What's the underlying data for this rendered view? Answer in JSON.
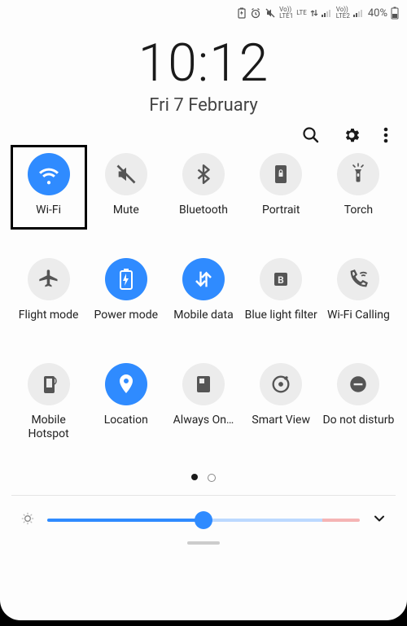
{
  "status": {
    "battery_percent": "40%",
    "carrier1": "LTE1",
    "carrier2": "LTE2",
    "volte1": "Vo))",
    "volte2": "Vo))",
    "net": "LTE"
  },
  "clock": "10:12",
  "date": "Fri 7 February",
  "actions": {
    "search": "search-icon",
    "settings": "gear-icon",
    "more": "more-icon"
  },
  "tiles": [
    {
      "id": "wifi",
      "label": "Wi-Fi",
      "active": true
    },
    {
      "id": "mute",
      "label": "Mute",
      "active": false
    },
    {
      "id": "bluetooth",
      "label": "Bluetooth",
      "active": false
    },
    {
      "id": "portrait",
      "label": "Portrait",
      "active": false
    },
    {
      "id": "torch",
      "label": "Torch",
      "active": false
    },
    {
      "id": "flight",
      "label": "Flight mode",
      "active": false
    },
    {
      "id": "power",
      "label": "Power mode",
      "active": true
    },
    {
      "id": "mobiledata",
      "label": "Mobile data",
      "active": true
    },
    {
      "id": "bluelight",
      "label": "Blue light filter",
      "active": false
    },
    {
      "id": "wificalling",
      "label": "Wi-Fi Calling",
      "active": false
    },
    {
      "id": "hotspot",
      "label": "Mobile Hotspot",
      "active": false
    },
    {
      "id": "location",
      "label": "Location",
      "active": true
    },
    {
      "id": "alwayson",
      "label": "Always On…",
      "active": false
    },
    {
      "id": "smartview",
      "label": "Smart View",
      "active": false
    },
    {
      "id": "dnd",
      "label": "Do not disturb",
      "active": false
    }
  ],
  "pager": {
    "pages": 2,
    "current": 0
  },
  "brightness": {
    "percent": 50,
    "auto": false
  },
  "colors": {
    "accent": "#2f8bff",
    "tile_off": "#ececec"
  }
}
